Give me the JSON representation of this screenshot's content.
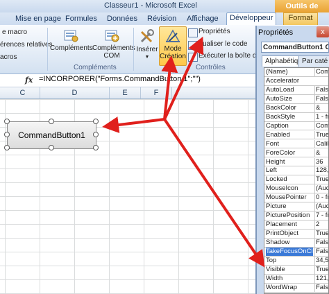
{
  "window": {
    "title": "Classeur1 - Microsoft Excel",
    "context_tab": "Outils de dessin"
  },
  "ribbon_tabs": [
    "Mise en page",
    "Formules",
    "Données",
    "Révision",
    "Affichage",
    "Développeur",
    "Format"
  ],
  "active_tab": "Développeur",
  "ribbon": {
    "left_items": [
      "e macro",
      "érences relatives",
      "acros"
    ],
    "complements_btn": "Compléments",
    "complements_com_btn": [
      "Compléments",
      "COM"
    ],
    "complements_group": "Compléments",
    "inserer_btn": "Insérer",
    "mode_creation_btn": [
      "Mode",
      "Création"
    ],
    "proprietes": "Propriétés",
    "visualiser_code": "ualiser le code",
    "executer": "Exécuter la boîte de",
    "controles_group": "Contrôles"
  },
  "formula_bar": {
    "fx": "fx",
    "formula": "=INCORPORER(\"Forms.CommandButton.1\";\"\")"
  },
  "columns": [
    "C",
    "D",
    "E",
    "F"
  ],
  "command_button": "CommandButton1",
  "properties": {
    "title": "Propriétés",
    "close": "x",
    "object_combo": "CommandButton1 Co",
    "tab_alpha": "Alphabétique",
    "tab_cat": "Par caté",
    "rows": [
      {
        "name": "(Name)",
        "value": "Comr"
      },
      {
        "name": "Accelerator",
        "value": ""
      },
      {
        "name": "AutoLoad",
        "value": "False"
      },
      {
        "name": "AutoSize",
        "value": "False"
      },
      {
        "name": "BackColor",
        "value": "&"
      },
      {
        "name": "BackStyle",
        "value": "1 - fm"
      },
      {
        "name": "Caption",
        "value": "Comr"
      },
      {
        "name": "Enabled",
        "value": "True"
      },
      {
        "name": "Font",
        "value": "Calibr"
      },
      {
        "name": "ForeColor",
        "value": "&"
      },
      {
        "name": "Height",
        "value": "36"
      },
      {
        "name": "Left",
        "value": "128,2"
      },
      {
        "name": "Locked",
        "value": "True"
      },
      {
        "name": "MouseIcon",
        "value": "(Aucu"
      },
      {
        "name": "MousePointer",
        "value": "0 - fr"
      },
      {
        "name": "Picture",
        "value": "(Aucu"
      },
      {
        "name": "PicturePosition",
        "value": "7 - fm"
      },
      {
        "name": "Placement",
        "value": "2"
      },
      {
        "name": "PrintObject",
        "value": "True"
      },
      {
        "name": "Shadow",
        "value": "False"
      },
      {
        "name": "TakeFocusOnClick",
        "value": "False"
      },
      {
        "name": "Top",
        "value": "34,5"
      },
      {
        "name": "Visible",
        "value": "True"
      },
      {
        "name": "Width",
        "value": "121,5"
      },
      {
        "name": "WordWrap",
        "value": "False"
      }
    ],
    "selected_row": "TakeFocusOnClick"
  },
  "colors": {
    "arrow": "#e0201c",
    "selection": "#3a79d7",
    "mode_button": "#ffc84a"
  }
}
